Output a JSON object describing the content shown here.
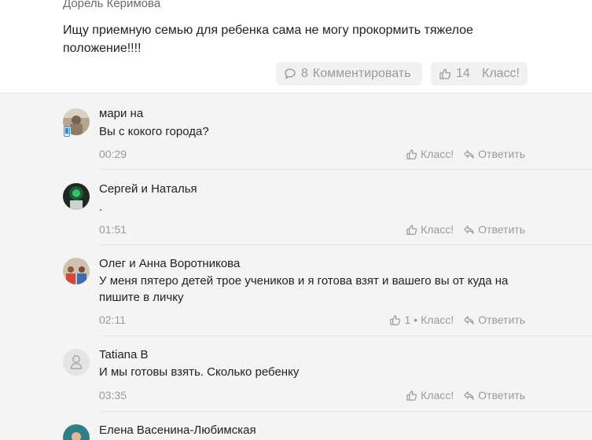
{
  "post": {
    "author": "Дорель Керимова",
    "text": "Ищу приемную семью для ребенка сама не могу прокормить тяжелое положение!!!!",
    "comments_count": "8",
    "comment_label": "Комментировать",
    "likes_count": "14",
    "class_label": "Класс!"
  },
  "icons": {
    "comment": "speech-bubble-icon",
    "like": "thumbs-up-icon",
    "reply": "reply-arrow-icon",
    "default_avatar": "user-silhouette-icon",
    "mobile": "mobile-phone-icon"
  },
  "comments": [
    {
      "author": "мари на",
      "text": "Вы с кокого города?",
      "time": "00:29",
      "like_label": "Класс!",
      "reply_label": "Ответить",
      "likes": ""
    },
    {
      "author": "Сергей и Наталья",
      "text": ".",
      "time": "01:51",
      "like_label": "Класс!",
      "reply_label": "Ответить",
      "likes": ""
    },
    {
      "author": "Олег и Анна Воротникова",
      "text": "У меня пятеро детей трое учеников и я готова взят и вашего вы от куда на пишите в личку",
      "time": "02:11",
      "like_label": "Класс!",
      "reply_label": "Ответить",
      "likes": "1"
    },
    {
      "author": "Tatiana B",
      "text": "И мы готовы взять. Сколько ребенку",
      "time": "03:35",
      "like_label": "Класс!",
      "reply_label": "Ответить",
      "likes": ""
    },
    {
      "author": "Елена Васенина-Любимская"
    }
  ],
  "colors": {
    "accent_green": "#4caf50",
    "meta_gray": "#9a9a9a",
    "panel_bg": "#f4f4f4",
    "pill_bg": "#f1f1f1"
  }
}
